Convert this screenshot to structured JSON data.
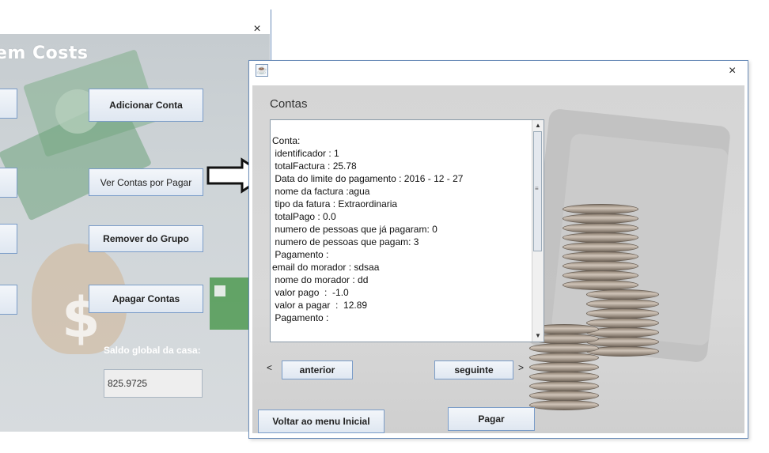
{
  "background_window": {
    "title_fragment": "em Costs",
    "close_symbol": "×",
    "buttons": {
      "adicionar_conta": "Adicionar Conta",
      "ver_contas_por_pagar": "Ver Contas por Pagar",
      "remover_do_grupo": "Remover do Grupo",
      "apagar_contas": "Apagar Contas"
    },
    "saldo_label": "Saldo global da casa:",
    "saldo_value": "825.9725"
  },
  "front_window": {
    "close_symbol": "×",
    "title": "Contas",
    "text_lines": [
      "Conta:",
      " identificador : 1",
      " totalFactura : 25.78",
      " Data do limite do pagamento : 2016 - 12 - 27",
      " nome da factura :agua",
      " tipo da fatura : Extraordinaria",
      " totalPago : 0.0",
      " numero de pessoas que já pagaram: 0",
      " numero de pessoas que pagam: 3",
      "",
      " Pagamento :",
      "email do morador : sdsaa",
      " nome do morador : dd",
      " valor pago  :  -1.0",
      " valor a pagar  :  12.89",
      "",
      " Pagamento :"
    ],
    "nav_prev_symbol": "<",
    "nav_next_symbol": ">",
    "buttons": {
      "anterior": "anterior",
      "seguinte": "seguinte",
      "pagar": "Pagar",
      "voltar": "Voltar ao menu Inicial"
    }
  },
  "colors": {
    "button_border": "#7a9cc8",
    "window_border": "#6a8cb8",
    "panel_gray": "#d5d5d5"
  },
  "icons": [
    "close-icon",
    "java-app-icon",
    "arrow-right-icon",
    "scroll-up-icon",
    "scroll-down-icon"
  ]
}
